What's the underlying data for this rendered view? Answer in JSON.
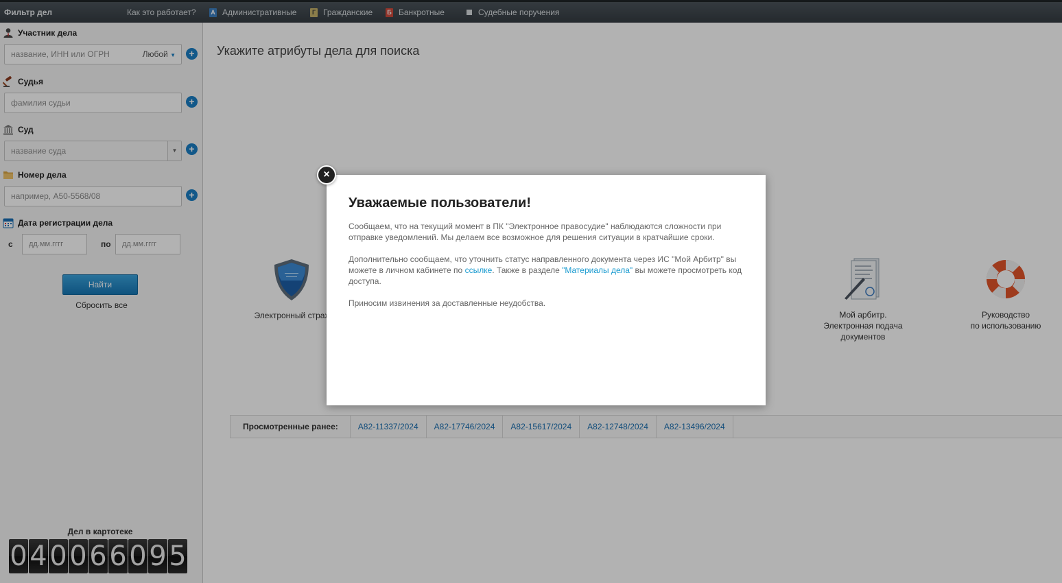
{
  "topbar": {
    "title": "Фильтр дел",
    "howto": "Как это работает?",
    "categories": [
      {
        "badge": "А",
        "label": "Административные",
        "color": "#3d7fc1"
      },
      {
        "badge": "Г",
        "label": "Гражданские",
        "color": "#c8b46a"
      },
      {
        "badge": "Б",
        "label": "Банкротные",
        "color": "#d04a3c"
      },
      {
        "badge": "",
        "label": "Судебные поручения",
        "color": "#d8dde0"
      }
    ]
  },
  "sidebar": {
    "participant": {
      "label": "Участник дела",
      "placeholder": "название, ИНН или ОГРН",
      "mode": "Любой"
    },
    "judge": {
      "label": "Судья",
      "placeholder": "фамилия судьи"
    },
    "court": {
      "label": "Суд",
      "placeholder": "название суда"
    },
    "case_number": {
      "label": "Номер дела",
      "placeholder": "например, А50-5568/08"
    },
    "reg_date": {
      "label": "Дата регистрации дела",
      "from_label": "с",
      "to_label": "по",
      "from_placeholder": "дд.мм.гггг",
      "to_placeholder": "дд.мм.гггг"
    },
    "find_button": "Найти",
    "reset_link": "Сбросить все",
    "counter_label": "Дел в картотеке",
    "counter_digits": [
      "0",
      "4",
      "0",
      "0",
      "6",
      "6",
      "0",
      "9",
      "5"
    ]
  },
  "main": {
    "heading": "Укажите атрибуты дела для поиска",
    "tiles": {
      "insurance": {
        "line1": "Электронный страх"
      },
      "my_arbitr": {
        "line1": "Мой арбитр.",
        "line2": "Электронная подача",
        "line3": "документов"
      },
      "guide": {
        "line1": "Руководство",
        "line2": "по использованию"
      }
    },
    "viewed": {
      "label": "Просмотренные ранее:",
      "links": [
        "А82-11337/2024",
        "А82-17746/2024",
        "А82-15617/2024",
        "А82-12748/2024",
        "А82-13496/2024"
      ]
    }
  },
  "modal": {
    "title": "Уважаемые пользователи!",
    "p1": "Сообщаем, что на текущий момент в ПК \"Электронное правосудие\" наблюдаются сложности при отправке уведомлений. Мы делаем все возможное для решения ситуации в кратчайшие сроки.",
    "p2_a": "Дополнительно сообщаем, что уточнить статус направленного документа через ИС \"Мой Арбитр\" вы можете в личном кабинете по ",
    "p2_link1": "ссылке",
    "p2_b": ". Также в разделе ",
    "p2_link2": "\"Материалы дела\"",
    "p2_c": " вы можете просмотреть код доступа.",
    "p3": "Приносим извинения за доставленные неудобства.",
    "close": "×"
  }
}
